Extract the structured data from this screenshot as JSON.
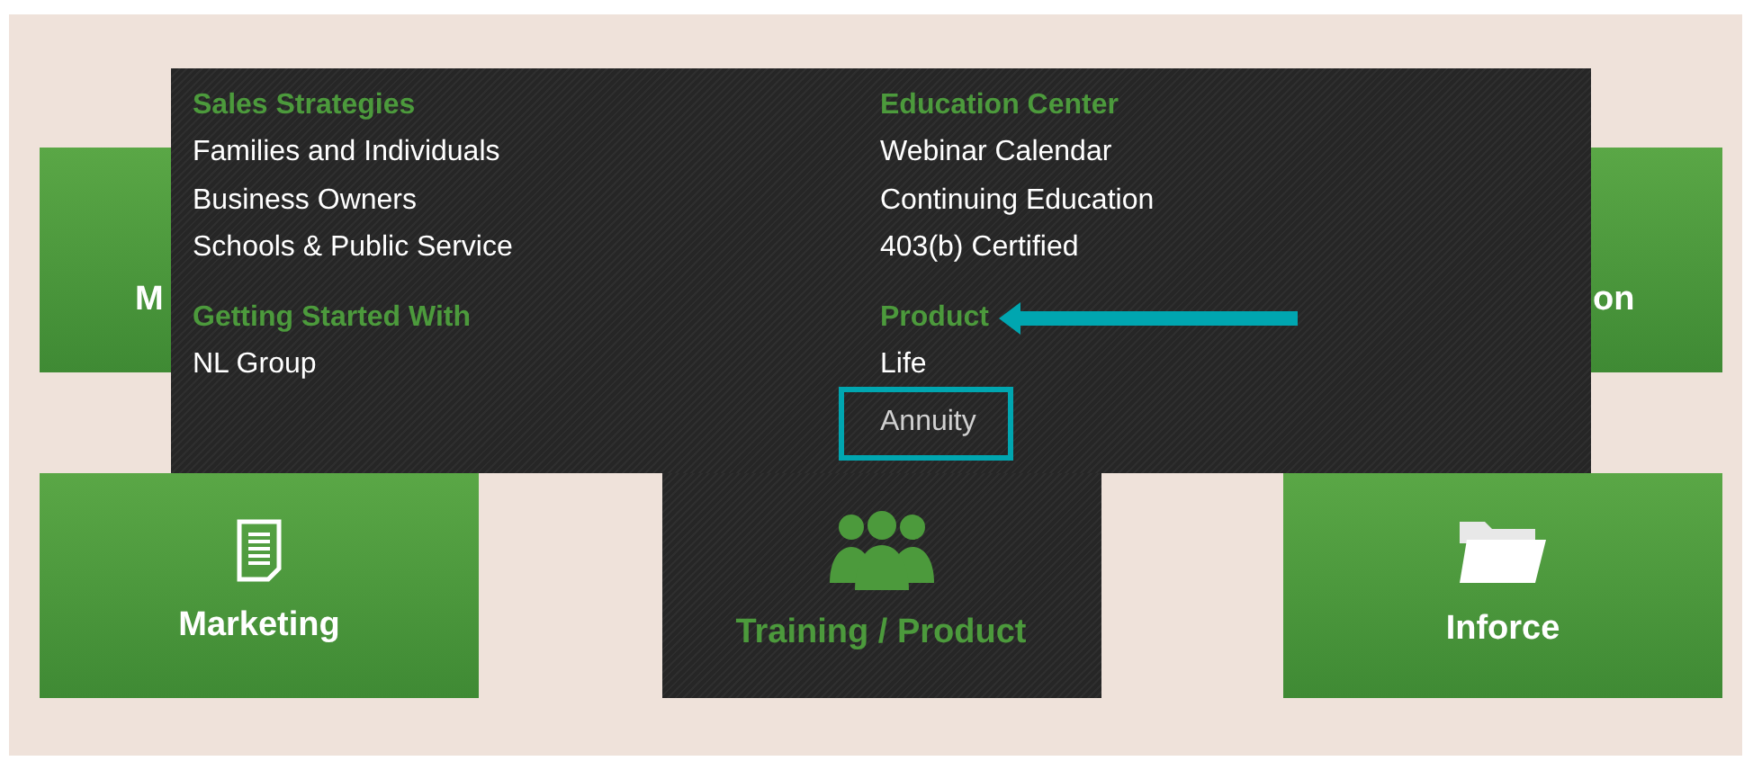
{
  "top_tiles": [
    {
      "label": "M"
    },
    {
      "label": "on"
    }
  ],
  "menu": {
    "columns": [
      {
        "sections": [
          {
            "heading": "Sales Strategies",
            "arrow_annotation": false,
            "items": [
              {
                "label": "Families and Individuals",
                "highlighted": false
              },
              {
                "label": "Business Owners",
                "highlighted": false
              },
              {
                "label": "Schools & Public Service",
                "highlighted": false
              }
            ]
          },
          {
            "heading": "Getting Started With",
            "arrow_annotation": false,
            "items": [
              {
                "label": "NL Group",
                "highlighted": false
              }
            ]
          }
        ]
      },
      {
        "sections": [
          {
            "heading": "Education Center",
            "arrow_annotation": false,
            "items": [
              {
                "label": "Webinar Calendar",
                "highlighted": false
              },
              {
                "label": "Continuing Education",
                "highlighted": false
              },
              {
                "label": "403(b) Certified",
                "highlighted": false
              }
            ]
          },
          {
            "heading": "Product",
            "arrow_annotation": true,
            "items": [
              {
                "label": "Life",
                "highlighted": false
              },
              {
                "label": "Annuity",
                "highlighted": true
              }
            ]
          }
        ]
      }
    ]
  },
  "tiles": [
    {
      "label": "Marketing",
      "kind": "document",
      "active": false
    },
    {
      "label": "Training / Product",
      "kind": "people",
      "active": true
    },
    {
      "label": "Inforce",
      "kind": "folder",
      "active": false
    }
  ]
}
